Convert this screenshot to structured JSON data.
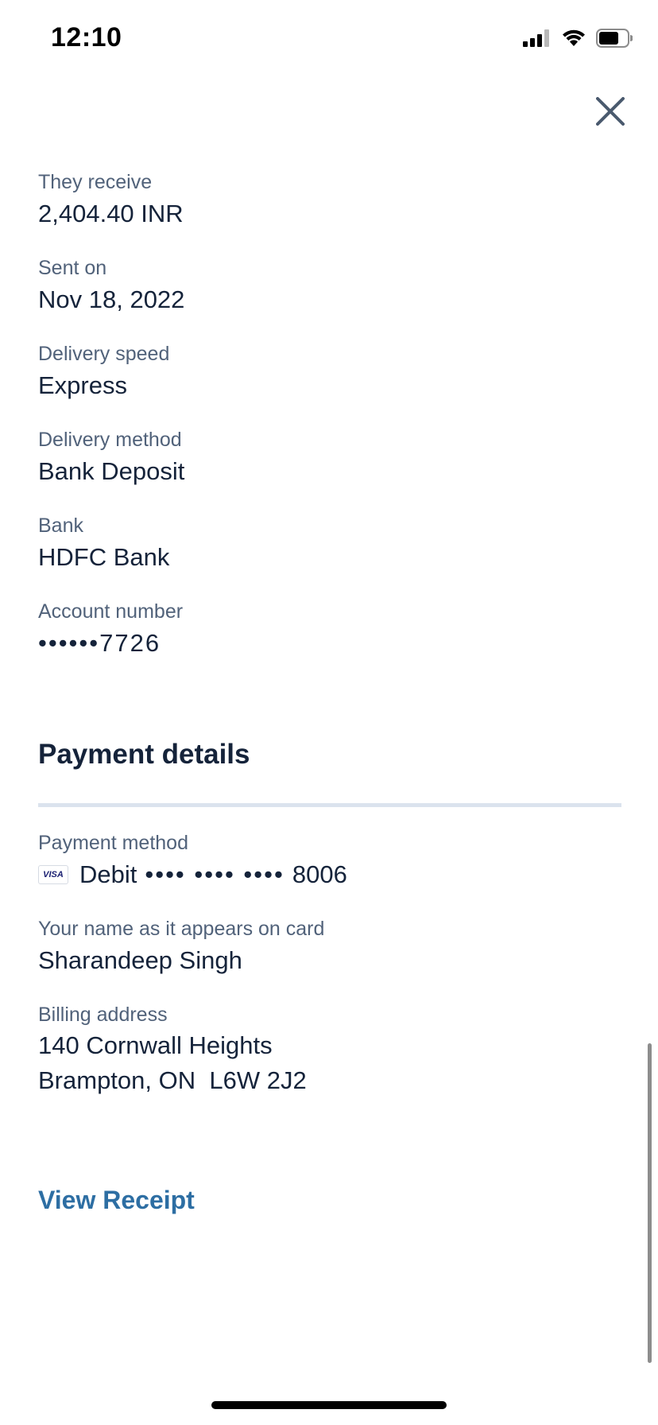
{
  "status_bar": {
    "time": "12:10"
  },
  "transfer_details": {
    "fields": [
      {
        "label": "They receive",
        "value": "2,404.40 INR"
      },
      {
        "label": "Sent on",
        "value": "Nov 18, 2022"
      },
      {
        "label": "Delivery speed",
        "value": "Express"
      },
      {
        "label": "Delivery method",
        "value": "Bank Deposit"
      },
      {
        "label": "Bank",
        "value": "HDFC Bank"
      },
      {
        "label": "Account number",
        "value": "••••••7726"
      }
    ]
  },
  "payment_details": {
    "title": "Payment details",
    "payment_method": {
      "label": "Payment method",
      "card_brand": "VISA",
      "card_type": "Debit",
      "masked": "•••• •••• ••••",
      "last4": "8006"
    },
    "cardholder": {
      "label": "Your name as it appears on card",
      "value": "Sharandeep Singh"
    },
    "billing_address": {
      "label": "Billing address",
      "line1": "140 Cornwall Heights",
      "line2": "Brampton, ON  L6W 2J2"
    }
  },
  "actions": {
    "view_receipt": "View Receipt"
  },
  "icons": {
    "close": "close-icon",
    "signal": "cellular-signal-icon",
    "wifi": "wifi-icon",
    "battery": "battery-icon"
  },
  "colors": {
    "link": "#2d6ea3",
    "label": "#51627a",
    "value": "#15233a",
    "divider": "#dbe3ee",
    "close_icon": "#4a5a6e"
  }
}
